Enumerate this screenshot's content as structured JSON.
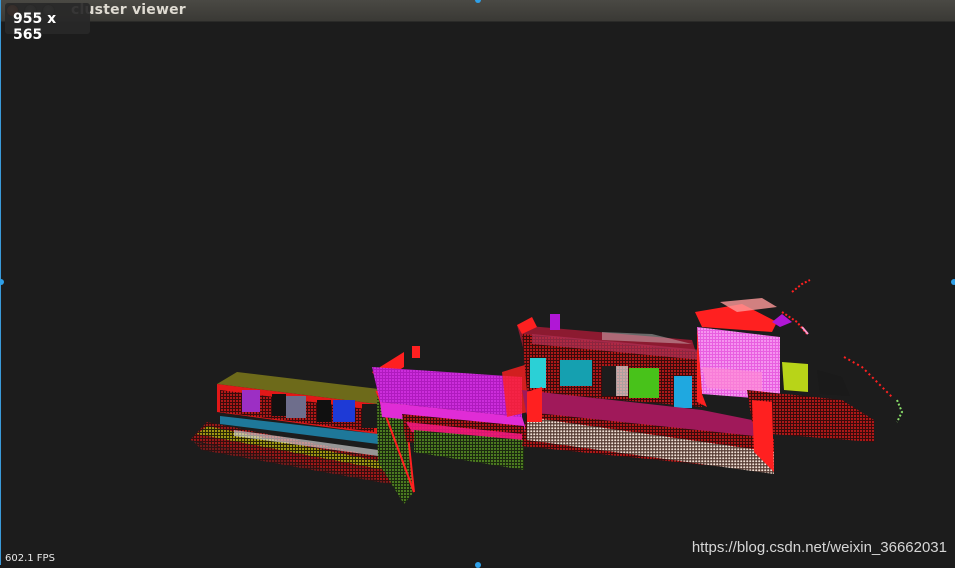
{
  "window": {
    "title": "cluster viewer",
    "size_tooltip": "955 x 565"
  },
  "viewer": {
    "fps_label": "602.1 FPS",
    "watermark": "https://blog.csdn.net/weixin_36662031"
  },
  "colors": {
    "background": "#1c1c1c",
    "border_red": "#ff1a1a",
    "accent_blue": "#2fa0e8"
  }
}
